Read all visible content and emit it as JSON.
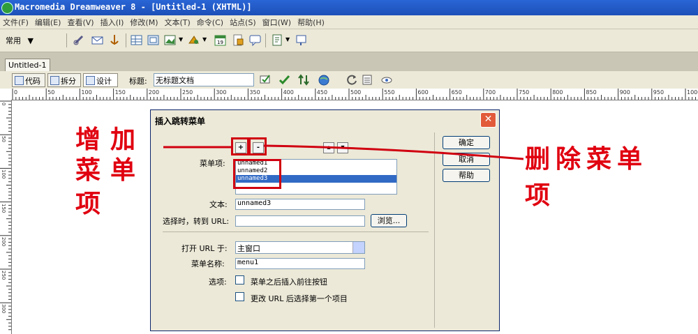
{
  "app": {
    "title": "Macromedia Dreamweaver 8 - [Untitled-1 (XHTML)]"
  },
  "menu": [
    "文件(F)",
    "编辑(E)",
    "查看(V)",
    "插入(I)",
    "修改(M)",
    "文本(T)",
    "命令(C)",
    "站点(S)",
    "窗口(W)",
    "帮助(H)"
  ],
  "insert_toolbar": {
    "category": "常用"
  },
  "doc_tab": {
    "label": "Untitled-1"
  },
  "doc_toolbar": {
    "code_label": "代码",
    "split_label": "拆分",
    "design_label": "设计",
    "title_label": "标题:",
    "title_value": "无标题文档"
  },
  "ruler": {
    "marks": [
      "0",
      "50",
      "100",
      "150",
      "200",
      "250",
      "300",
      "350",
      "400",
      "450",
      "500",
      "550",
      "600",
      "650",
      "700",
      "750",
      "800",
      "850",
      "900",
      "950",
      "1000"
    ],
    "vmarks": [
      "0",
      "50",
      "100",
      "150",
      "200",
      "250",
      "300"
    ]
  },
  "dialog": {
    "title": "插入跳转菜单",
    "ok": "确定",
    "cancel": "取消",
    "help": "帮助",
    "plus": "+",
    "minus": "-",
    "menu_items_label": "菜单项:",
    "menu_items": [
      "unnamed1",
      "unnamed2",
      "unnamed3"
    ],
    "selected_index": 2,
    "text_label": "文本:",
    "text_value": "unnamed3",
    "url_label": "选择时，转到 URL:",
    "url_value": "",
    "browse": "浏览...",
    "open_url_label": "打开 URL 于:",
    "open_url_value": "主窗口",
    "menu_name_label": "菜单名称:",
    "menu_name_value": "menu1",
    "options_label": "选项:",
    "option1": "菜单之后插入前往按钮",
    "option2": "更改 URL 后选择第一个项目"
  },
  "annotations": {
    "add_line1": "增加",
    "add_line2": "菜单",
    "add_line3": "项",
    "delete_line1": "删除菜单",
    "delete_line2": "项"
  }
}
